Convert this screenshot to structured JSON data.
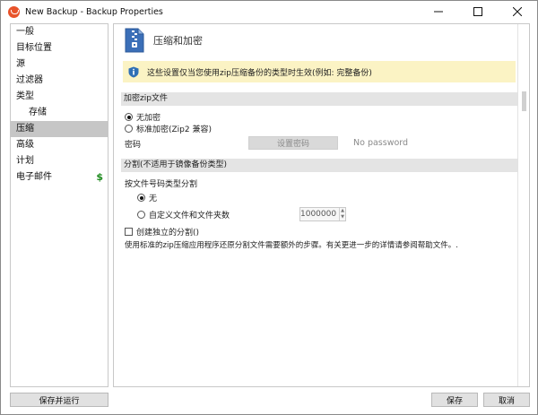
{
  "window": {
    "title": "New Backup - Backup Properties",
    "minimize_icon": "minimize-icon",
    "maximize_icon": "maximize-icon",
    "close_icon": "close-icon"
  },
  "sidebar": {
    "items": [
      {
        "label": "一般"
      },
      {
        "label": "目标位置"
      },
      {
        "label": "源"
      },
      {
        "label": "过滤器"
      },
      {
        "label": "类型"
      },
      {
        "label": "存储"
      },
      {
        "label": "压缩"
      },
      {
        "label": "高级"
      },
      {
        "label": "计划"
      },
      {
        "label": "电子邮件"
      }
    ],
    "dollar_glyph": "$"
  },
  "content": {
    "title": "压缩和加密",
    "info_text": "这些设置仅当您使用zip压缩备份的类型时生效(例如: 完整备份)",
    "encrypt": {
      "section": "加密zip文件",
      "option_none": "无加密",
      "option_standard": "标准加密(Zip2 兼容)",
      "password_label": "密码",
      "set_password_button": "设置密码",
      "no_password": "No password"
    },
    "split": {
      "section": "分割(不适用于镜像备份类型)",
      "subhead": "按文件号码类型分割",
      "option_none": "无",
      "option_custom": "自定义文件和文件夹数",
      "custom_value": "1000000",
      "independent_split": "创建独立的分割()",
      "note": "使用标准的zip压缩应用程序还原分割文件需要额外的步骤。有关更进一步的详情请参阅帮助文件。."
    }
  },
  "footer": {
    "save_run": "保存并运行",
    "save": "保存",
    "cancel": "取消"
  },
  "colors": {
    "info_bg": "#fbf3c4",
    "selected_nav": "#c6c6c6",
    "dollar": "#1d8a1d",
    "app_icon": "#e8532a",
    "shield": "#2f6fb5"
  }
}
